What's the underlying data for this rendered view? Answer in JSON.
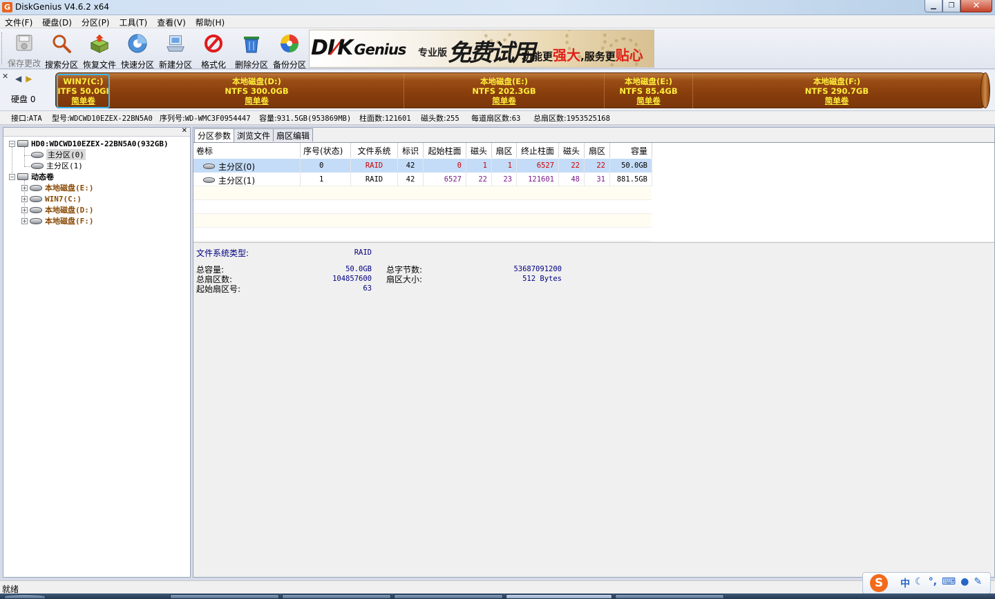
{
  "window": {
    "title": "DiskGenius V4.6.2 x64",
    "app_icon": "G"
  },
  "menu": [
    "文件(F)",
    "硬盘(D)",
    "分区(P)",
    "工具(T)",
    "查看(V)",
    "帮助(H)"
  ],
  "toolbar": [
    {
      "label": "保存更改",
      "icon": "save-disk-icon",
      "enabled": false
    },
    {
      "label": "搜索分区",
      "icon": "magnifier-icon",
      "enabled": true
    },
    {
      "label": "恢复文件",
      "icon": "recover-box-icon",
      "enabled": true
    },
    {
      "label": "快速分区",
      "icon": "quick-partition-icon",
      "enabled": true
    },
    {
      "label": "新建分区",
      "icon": "new-partition-icon",
      "enabled": true
    },
    {
      "label": "格式化",
      "icon": "format-icon",
      "enabled": true
    },
    {
      "label": "删除分区",
      "icon": "trash-icon",
      "enabled": true
    },
    {
      "label": "备份分区",
      "icon": "backup-disc-icon",
      "enabled": true
    }
  ],
  "banner": {
    "logo_a": "DI",
    "logo_b": "K",
    "logo_c": "Genius",
    "edition": "专业版",
    "slogan_big": "免费试用",
    "slogan_a": "功能更",
    "slogan_b": "强大",
    "slogan_c": ",服务更",
    "slogan_d": "贴心"
  },
  "diskmap": {
    "disk_label": "硬盘 0",
    "partitions": [
      {
        "name": "WIN7(C:)",
        "fs": "ITFS 50.0GI",
        "type": "简单卷",
        "selected": true
      },
      {
        "name": "本地磁盘(D:)",
        "fs": "NTFS 300.0GB",
        "type": "简单卷",
        "selected": false
      },
      {
        "name": "本地磁盘(E:)",
        "fs": "NTFS 202.3GB",
        "type": "简单卷",
        "selected": false
      },
      {
        "name": "本地磁盘(E:)",
        "fs": "NTFS 85.4GB",
        "type": "简单卷",
        "selected": false
      },
      {
        "name": "本地磁盘(F:)",
        "fs": "NTFS 290.7GB",
        "type": "简单卷",
        "selected": false
      }
    ]
  },
  "diskinfo": {
    "interface_label": "接口:",
    "interface": "ATA",
    "model_label": "型号:",
    "model": "WDCWD10EZEX-22BN5A0",
    "serial_label": "序列号:",
    "serial": "WD-WMC3F0954447",
    "capacity_label": "容量:",
    "capacity": "931.5GB(953869MB)",
    "cylinders_label": "柱面数:",
    "cylinders": "121601",
    "heads_label": "磁头数:",
    "heads": "255",
    "sectors_per_track_label": "每道扇区数:",
    "sectors_per_track": "63",
    "total_sectors_label": "总扇区数:",
    "total_sectors": "1953525168"
  },
  "tree": {
    "disk": "HD0:WDCWD10EZEX-22BN5A0(932GB)",
    "disk_parts": [
      "主分区(0)",
      "主分区(1)"
    ],
    "dynamic": "动态卷",
    "volumes": [
      "本地磁盘(E:)",
      "WIN7(C:)",
      "本地磁盘(D:)",
      "本地磁盘(F:)"
    ]
  },
  "tabs": [
    "分区参数",
    "浏览文件",
    "扇区编辑"
  ],
  "grid": {
    "headers": [
      "卷标",
      "序号(状态)",
      "文件系统",
      "标识",
      "起始柱面",
      "磁头",
      "扇区",
      "终止柱面",
      "磁头",
      "扇区",
      "容量"
    ],
    "rows": [
      [
        "主分区(0)",
        "0",
        "RAID",
        "42",
        "0",
        "1",
        "1",
        "6527",
        "22",
        "22",
        "50.0GB"
      ],
      [
        "主分区(1)",
        "1",
        "RAID",
        "42",
        "6527",
        "22",
        "23",
        "121601",
        "48",
        "31",
        "881.5GB"
      ]
    ]
  },
  "details": {
    "fs_type_label": "文件系统类型:",
    "fs_type": "RAID",
    "total_capacity_label": "总容量:",
    "total_capacity": "50.0GB",
    "total_sectors_label": "总扇区数:",
    "total_sectors": "104857600",
    "start_sector_label": "起始扇区号:",
    "start_sector": "63",
    "total_bytes_label": "总字节数:",
    "total_bytes": "53687091200",
    "sector_size_label": "扇区大小:",
    "sector_size": "512 Bytes"
  },
  "status": "就绪",
  "ime": {
    "logo": "S",
    "lang": "中"
  },
  "colors": {
    "partition_bar": "#8a3f0d",
    "partition_text": "#ffee3b",
    "selected_border": "#3ab8f0",
    "selected_row": "#c4dcf7",
    "red_value": "#cc0000",
    "purple_value": "#7a1a8a",
    "blue_label": "#000080"
  }
}
